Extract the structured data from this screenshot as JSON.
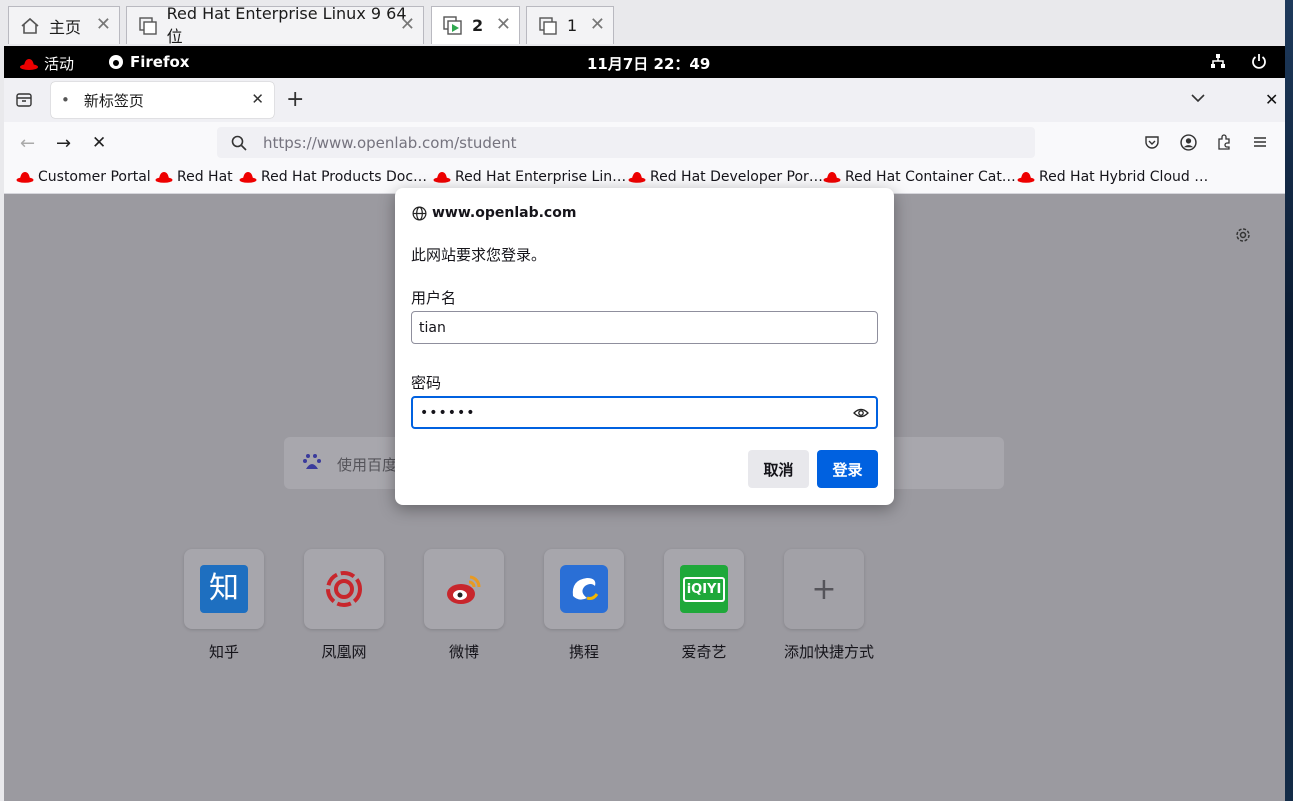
{
  "vm_tabs": [
    {
      "label": "主页",
      "icon": "home-icon"
    },
    {
      "label": "Red Hat Enterprise Linux 9 64 位",
      "icon": "vm-copy-icon"
    },
    {
      "label": "2",
      "icon": "vm-running-icon"
    },
    {
      "label": "1",
      "icon": "vm-copy-icon"
    }
  ],
  "gnome": {
    "activities": "活动",
    "app": "Firefox",
    "clock": "11月7日  22：49"
  },
  "firefox": {
    "tab_title": "新标签页",
    "url": "https://www.openlab.com/student",
    "bookmarks": [
      "Customer Portal",
      "Red Hat",
      "Red Hat Products Doc…",
      "Red Hat Enterprise Lin…",
      "Red Hat Developer Por…",
      "Red Hat Container Cat…",
      "Red Hat Hybrid Cloud …"
    ]
  },
  "newtab": {
    "search_placeholder": "使用百度",
    "sites": [
      {
        "label": "知乎",
        "icon": "zhihu-icon"
      },
      {
        "label": "凤凰网",
        "icon": "ifeng-icon"
      },
      {
        "label": "微博",
        "icon": "weibo-icon"
      },
      {
        "label": "携程",
        "icon": "ctrip-icon"
      },
      {
        "label": "爱奇艺",
        "icon": "iqiyi-icon"
      },
      {
        "label": "添加快捷方式",
        "icon": "add-icon"
      }
    ]
  },
  "dialog": {
    "host": "www.openlab.com",
    "message": "此网站要求您登录。",
    "username_label": "用户名",
    "username_value": "tian",
    "password_label": "密码",
    "password_value": "••••••",
    "cancel": "取消",
    "login": "登录"
  },
  "colors": {
    "accent": "#0061e0",
    "gnome_bar": "#000000",
    "redhat_red": "#ee0000"
  }
}
